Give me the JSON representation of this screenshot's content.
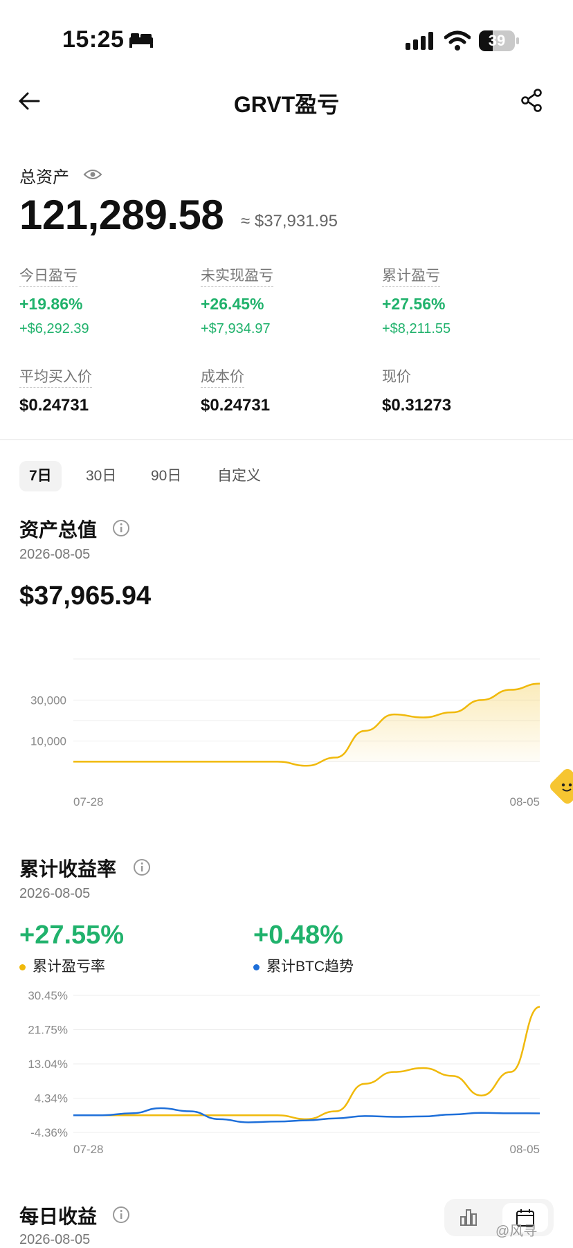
{
  "status_bar": {
    "time": "15:25",
    "battery": "39",
    "battery_level": 0.39
  },
  "nav": {
    "title": "GRVT盈亏"
  },
  "summary": {
    "total_label": "总资产",
    "total_value": "121,289.58",
    "total_usd": "≈ $37,931.95",
    "stats": [
      {
        "label": "今日盈亏",
        "pct": "+19.86%",
        "amount": "+$6,292.39"
      },
      {
        "label": "未实现盈亏",
        "pct": "+26.45%",
        "amount": "+$7,934.97"
      },
      {
        "label": "累计盈亏",
        "pct": "+27.56%",
        "amount": "+$8,211.55"
      }
    ],
    "prices": [
      {
        "label": "平均买入价",
        "value": "$0.24731"
      },
      {
        "label": "成本价",
        "value": "$0.24731"
      },
      {
        "label": "现价",
        "value": "$0.31273"
      }
    ]
  },
  "tabs": [
    "7日",
    "30日",
    "90日",
    "自定义"
  ],
  "active_tab": "7日",
  "asset_section": {
    "title": "资产总值",
    "date": "2026-08-05",
    "value": "$37,965.94"
  },
  "return_section": {
    "title": "累计收益率",
    "date": "2026-08-05",
    "series": [
      {
        "pct": "+27.55%",
        "label": "累计盈亏率"
      },
      {
        "pct": "+0.48%",
        "label": "累计BTC趋势"
      }
    ]
  },
  "daily_section": {
    "title": "每日收益",
    "date": "2026-08-05"
  },
  "watermark": "@风寻",
  "colors": {
    "green": "#20b26c",
    "gold": "#f0b90b",
    "blue": "#1e6fd9"
  },
  "chart_data": [
    {
      "type": "area",
      "x_labels": [
        "07-28",
        "08-05"
      ],
      "ytick_labels": [
        "30,000",
        "10,000"
      ],
      "yticks": [
        30000,
        10000
      ],
      "ylim": [
        -10000,
        50000
      ],
      "x": [
        0,
        1,
        2,
        3,
        4,
        5,
        6,
        7,
        8,
        9,
        10,
        11,
        12,
        13,
        14,
        15,
        16
      ],
      "values": [
        0,
        0,
        0,
        0,
        0,
        0,
        0,
        0,
        -2000,
        2000,
        15000,
        23000,
        21500,
        24000,
        30000,
        35000,
        38000
      ],
      "color": "#f0b90b",
      "grid": true
    },
    {
      "type": "line",
      "x_labels": [
        "07-28",
        "08-05"
      ],
      "ytick_labels": [
        "30.45%",
        "21.75%",
        "13.04%",
        "4.34%",
        "-4.36%"
      ],
      "yticks": [
        30.45,
        21.75,
        13.04,
        4.34,
        -4.36
      ],
      "ylim": [
        -4.36,
        30.45
      ],
      "x": [
        0,
        1,
        2,
        3,
        4,
        5,
        6,
        7,
        8,
        9,
        10,
        11,
        12,
        13,
        14,
        15,
        16
      ],
      "series": [
        {
          "values": [
            0,
            0,
            0,
            0,
            0,
            0,
            0,
            0,
            -1,
            1,
            8,
            11,
            12,
            10,
            5,
            11,
            27.55
          ],
          "color": "#f0b90b"
        },
        {
          "values": [
            0,
            0,
            0.5,
            1.8,
            1,
            -1,
            -1.8,
            -1.6,
            -1.3,
            -0.8,
            -0.2,
            -0.4,
            -0.3,
            0.2,
            0.6,
            0.5,
            0.48
          ],
          "color": "#1e6fd9"
        }
      ],
      "grid": true
    }
  ]
}
